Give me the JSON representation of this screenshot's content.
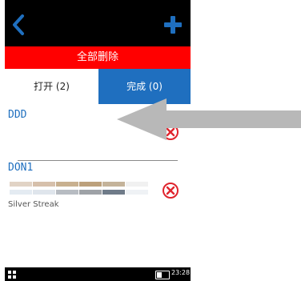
{
  "header": {
    "back_icon": "chevron-left-icon",
    "add_icon": "plus-icon",
    "accent_color": "#1f6fbf"
  },
  "delete_all_label": "全部删除",
  "tabs": {
    "open_label": "打开 (2)",
    "done_label": "完成 (0)"
  },
  "items": [
    {
      "name": "DDD",
      "remove_icon": "circle-x-icon"
    },
    {
      "name": "DON1",
      "remove_icon": "circle-x-icon",
      "caption": "Silver Streak",
      "swatch_rows": [
        [
          "#e1d3c5",
          "#d6c0ab",
          "#c8b08f",
          "#bca07b",
          "#c4b39a",
          "#f1f1f1"
        ],
        [
          "#e4ebf2",
          "#dfe5ec",
          "#b7bcc2",
          "#9ea2a7",
          "#6f7b89",
          "#eff2f5"
        ]
      ]
    }
  ],
  "status": {
    "time": "23:28",
    "battery_level": 0.45
  }
}
